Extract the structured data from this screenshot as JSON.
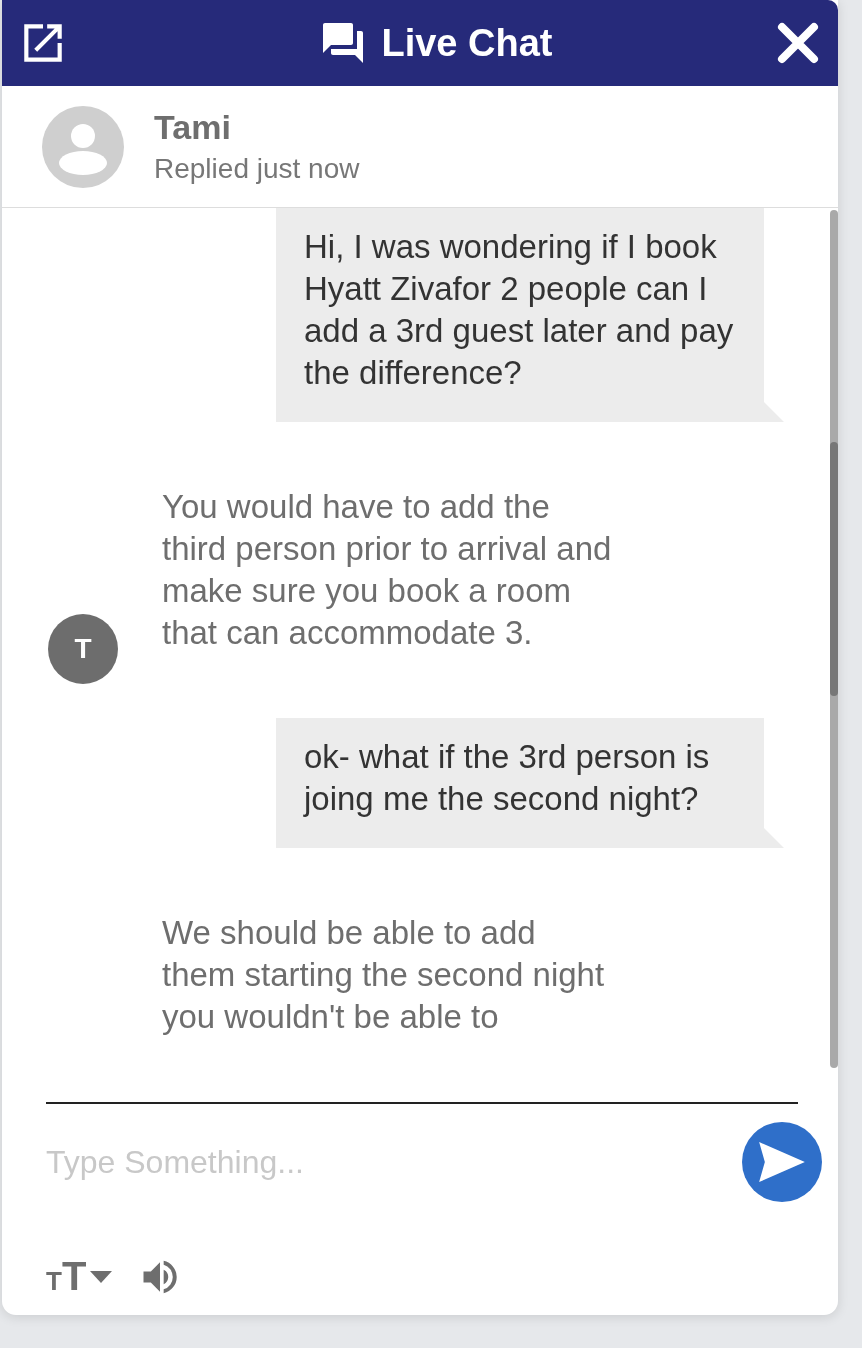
{
  "header": {
    "title": "Live Chat"
  },
  "contact": {
    "name": "Tami",
    "status": "Replied just now"
  },
  "messages": [
    {
      "kind": "sent",
      "text": "Hi, I was wondering if I book Hyatt Zivafor 2 people can I add a 3rd guest later and pay the difference?"
    },
    {
      "kind": "received",
      "text": "You would have to add the third person prior to arrival and make sure you book a room that can accommodate 3.",
      "avatar": "T"
    },
    {
      "kind": "sent",
      "text": "ok- what if the 3rd person is joing me the second night?"
    },
    {
      "kind": "received",
      "text": "We should be able to add them starting the second night you wouldn't be able to"
    }
  ],
  "composer": {
    "placeholder": "Type Something..."
  },
  "toolbar": {
    "font_size_label": "TT"
  }
}
